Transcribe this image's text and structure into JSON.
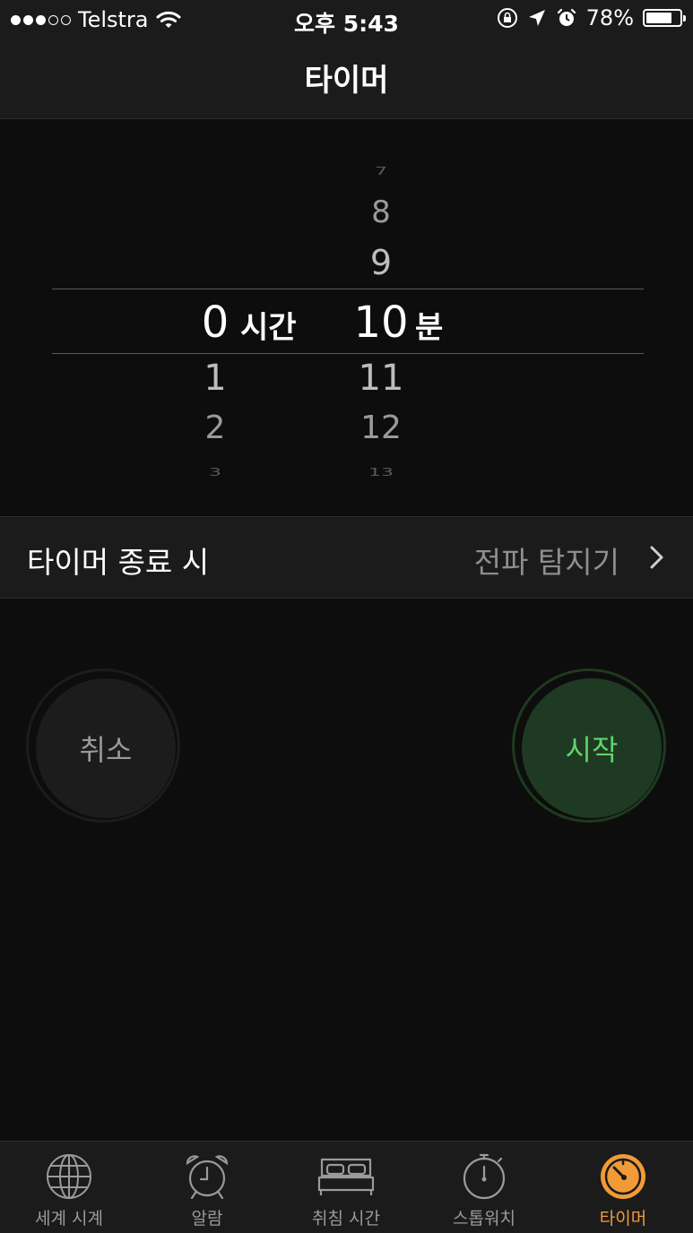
{
  "status_bar": {
    "carrier": "Telstra",
    "time": "오후 5:43",
    "battery": "78%",
    "battery_level": 0.78
  },
  "nav": {
    "title": "타이머"
  },
  "picker": {
    "hours": {
      "above": [
        "",
        "",
        ""
      ],
      "selected": "0",
      "below": [
        "1",
        "2",
        "3"
      ],
      "unit": "시간"
    },
    "minutes": {
      "above": [
        "7",
        "8",
        "9"
      ],
      "selected": "10",
      "below": [
        "11",
        "12",
        "13"
      ],
      "unit": "분"
    }
  },
  "when_timer_ends": {
    "label": "타이머 종료 시",
    "value": "전파 탐지기"
  },
  "buttons": {
    "cancel": "취소",
    "start": "시작"
  },
  "tabs": [
    {
      "label": "세계 시계",
      "icon": "globe-icon"
    },
    {
      "label": "알람",
      "icon": "alarm-clock-icon"
    },
    {
      "label": "취침 시간",
      "icon": "bed-icon"
    },
    {
      "label": "스톱워치",
      "icon": "stopwatch-icon"
    },
    {
      "label": "타이머",
      "icon": "timer-icon",
      "active": true
    }
  ],
  "colors": {
    "accent": "#f19a37",
    "start_green": "#5fd36a"
  }
}
